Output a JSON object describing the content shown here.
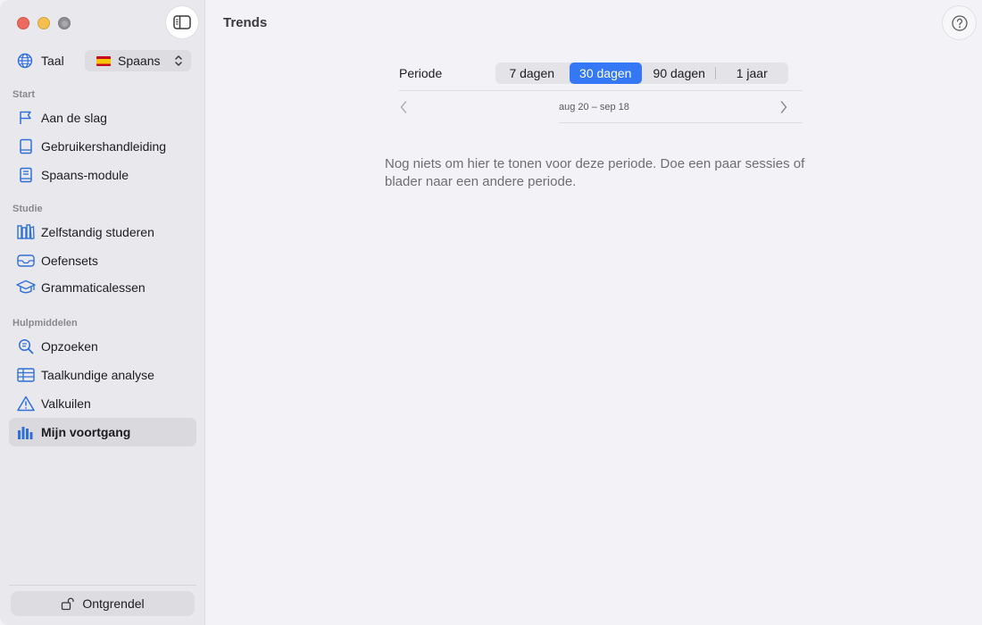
{
  "window": {
    "title": "Trends"
  },
  "sidebar": {
    "language": {
      "label": "Taal",
      "selected": "Spaans"
    },
    "sections": [
      {
        "heading": "Start",
        "items": [
          {
            "label": "Aan de slag",
            "icon": "flag-icon"
          },
          {
            "label": "Gebruikershandleiding",
            "icon": "book-icon"
          },
          {
            "label": "Spaans-module",
            "icon": "book-closed-icon"
          }
        ]
      },
      {
        "heading": "Studie",
        "items": [
          {
            "label": "Zelfstandig studeren",
            "icon": "books-vertical-icon"
          },
          {
            "label": "Oefensets",
            "icon": "tray-icon"
          },
          {
            "label": "Grammaticalessen",
            "icon": "graduation-cap-icon"
          }
        ]
      },
      {
        "heading": "Hulpmiddelen",
        "items": [
          {
            "label": "Opzoeken",
            "icon": "magnifier-text-icon"
          },
          {
            "label": "Taalkundige analyse",
            "icon": "table-icon"
          },
          {
            "label": "Valkuilen",
            "icon": "warning-triangle-icon"
          },
          {
            "label": "Mijn voortgang",
            "icon": "bar-chart-icon",
            "active": true
          }
        ]
      }
    ],
    "unlock_label": "Ontgrendel"
  },
  "main": {
    "period_label": "Periode",
    "segments": [
      "7 dagen",
      "30 dagen",
      "90 dagen",
      "1 jaar"
    ],
    "selected_segment": "30 dagen",
    "date_range": "aug 20 – sep 18",
    "empty_message": "Nog niets om hier te tonen voor deze periode. Doe een paar sessies of blader naar een andere periode."
  },
  "colors": {
    "accent": "#3478f6",
    "sidebar_bg": "#e8e8ed",
    "content_bg": "#f2f2f7"
  }
}
